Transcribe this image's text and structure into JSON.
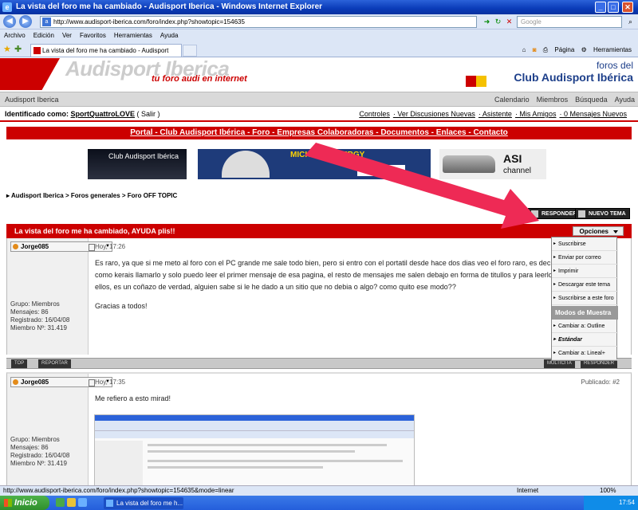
{
  "window": {
    "title": "La vista del foro me ha cambiado - Audisport Iberica - Windows Internet Explorer"
  },
  "browser": {
    "url": "http://www.audisport-iberica.com/foro/index.php?showtopic=154635",
    "search_placeholder": "Google",
    "menu": [
      "Archivo",
      "Edición",
      "Ver",
      "Favoritos",
      "Herramientas",
      "Ayuda"
    ],
    "tab_label": "La vista del foro me ha cambiado - Audisport Iberica",
    "tools": {
      "page": "Página",
      "tools": "Herramientas"
    },
    "status_url": "http://www.audisport-iberica.com/foro/index.php?showtopic=154635&mode=linear",
    "status_zone": "Internet",
    "status_zoom": "100%"
  },
  "site": {
    "logo_name": "Audisport Iberica",
    "logo_tagline": "tu foro audi en internet",
    "club_top": "foros del",
    "club_name": "Club Audisport Ibérica",
    "nav_left": "Audisport Iberica",
    "nav_right": [
      "Calendario",
      "Miembros",
      "Búsqueda",
      "Ayuda"
    ],
    "ident_label": "Identificado como:",
    "ident_user": "SportQuattroLOVE",
    "ident_exit": "( Salir )",
    "ident_links": [
      "Controles",
      "· Ver Discusiones Nuevas",
      "· Asistente",
      "· Mis Amigos",
      "· 0 Mensajes Nuevos"
    ],
    "main_nav": "Portal - Club Audisport Ibérica - Foro - Empresas Colaboradoras - Documentos - Enlaces - Contacto",
    "banner1": "Club Audisport Ibérica",
    "banner2_brand": "MICHELIN ENERGY",
    "banner2_logo": "MICHELIN",
    "banner3_title": "ASI",
    "banner3_sub": "channel"
  },
  "thread": {
    "breadcrumb": "▸ Audisport Iberica > Foros generales > Foro OFF TOPIC",
    "reply_button": "RESPONDER",
    "new_topic_button": "NUEVO TEMA",
    "title": "La vista del foro me ha cambiado, AYUDA plis!!",
    "options_label": "Opciones"
  },
  "options_menu": {
    "items": [
      "Suscribirse",
      "Enviar por correo",
      "Imprimir",
      "Descargar este tema",
      "Suscribirse a este foro"
    ],
    "section": "Modos de Muestra",
    "modes": [
      "Cambiar a: Outline",
      "Estándar",
      "Cambiar a: Lineal+"
    ]
  },
  "posts": [
    {
      "author": "Jorge085",
      "date": "Hoy, 17:26",
      "group": "Grupo: Miembros",
      "messages": "Mensajes: 86",
      "registered": "Registrado: 16/04/08",
      "member": "Miembro Nº: 31.419",
      "text1": "Es raro, ya que si me meto al foro con el PC grande me sale todo bien, pero si entro con el portatil desde hace dos dias veo el foro raro, es decir, me meto en",
      "text2": "como kerais llamarlo y solo puedo leer el primer mensaje de esa pagina, el resto de mensajes me salen debajo en forma de titullos y para leerlos tengo que cl",
      "text3": "ellos, es un coñazo de verdad, alguien sabe si le he dado a un sitio que no debia o algo? como quito ese modo??",
      "text4": "Gracias a todos!",
      "foot_top": "TOP",
      "foot_report": "REPORTAR",
      "foot_multi": "MULTICITA",
      "foot_reply": "RESPONDER"
    },
    {
      "author": "Jorge085",
      "date": "Hoy, 17:35",
      "published": "Publicado: #2",
      "group": "Grupo: Miembros",
      "messages": "Mensajes: 86",
      "registered": "Registrado: 16/04/08",
      "member": "Miembro Nº: 31.419",
      "text1": "Me refiero a esto mirad!"
    }
  ],
  "taskbar": {
    "start": "Inicio",
    "item": "La vista del foro me h...",
    "clock": "17:54"
  },
  "colors": {
    "brand_red": "#cc0000",
    "xp_blue": "#245edb",
    "arrow": "#ee2a55"
  }
}
